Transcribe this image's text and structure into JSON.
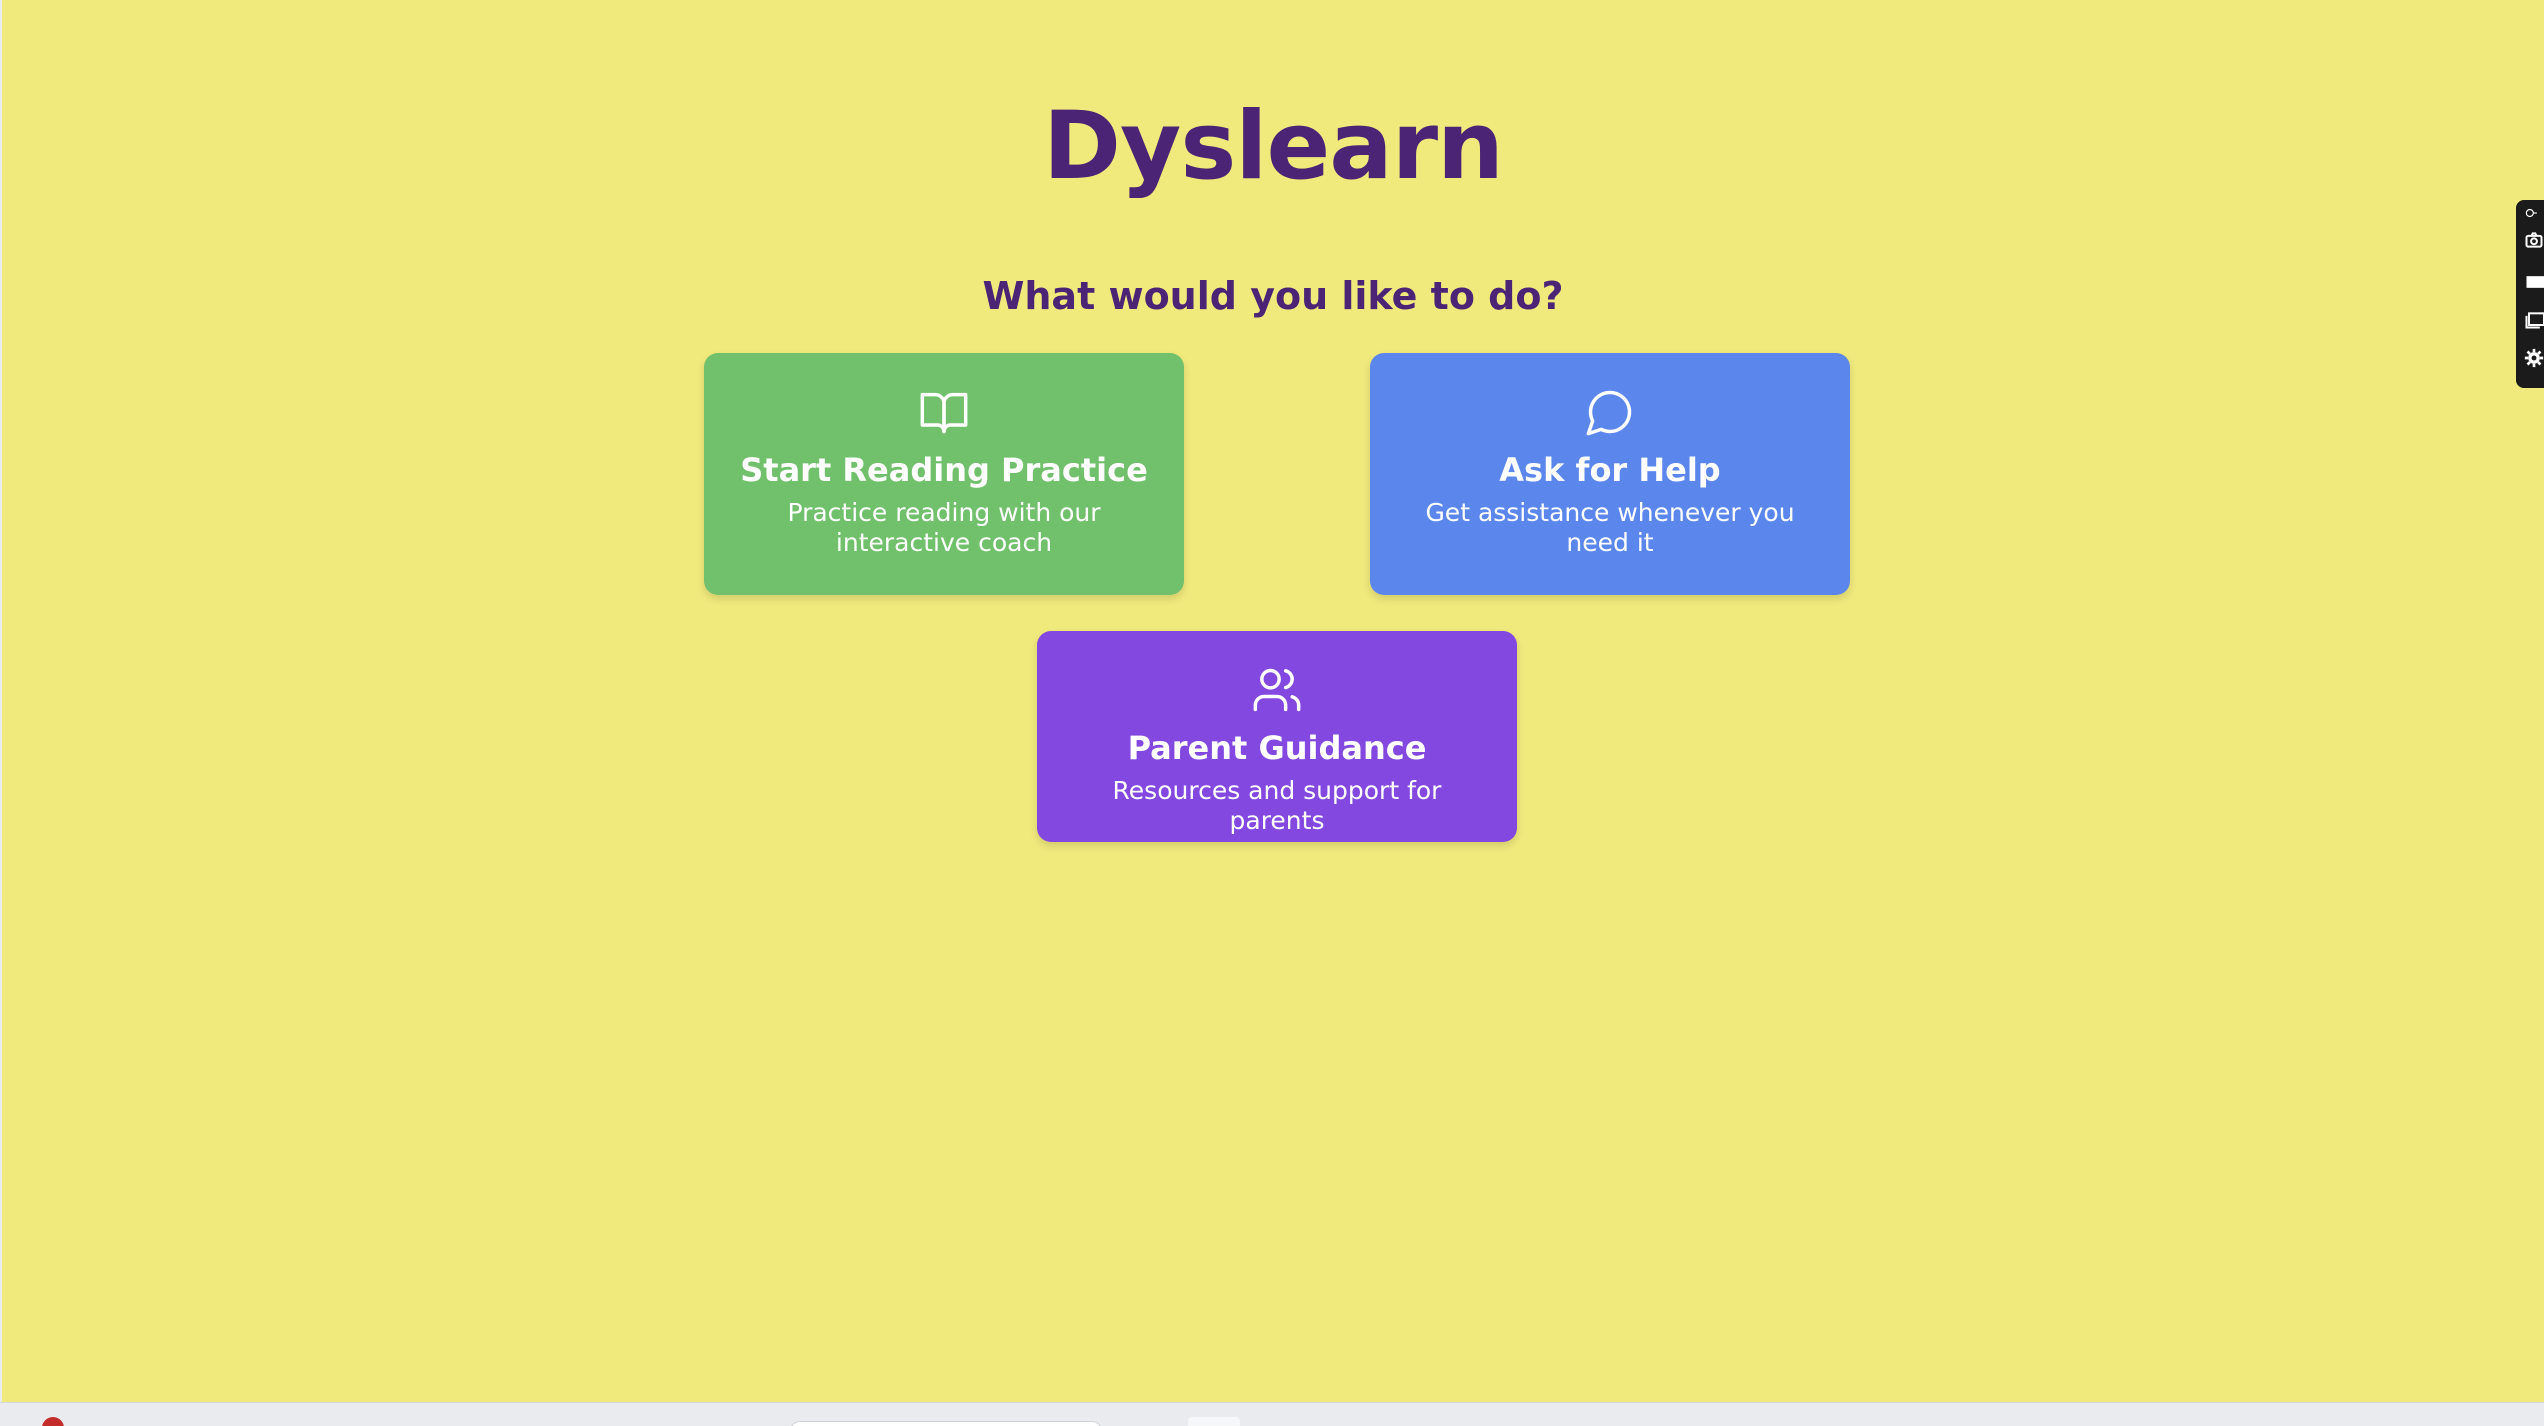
{
  "app": {
    "title": "Dyslearn",
    "prompt": "What would you like to do?"
  },
  "cards": {
    "reading": {
      "icon": "open-book-icon",
      "title": "Start Reading Practice",
      "description": "Practice reading with our interactive coach",
      "color": "#71c06b"
    },
    "help": {
      "icon": "chat-bubble-icon",
      "title": "Ask for Help",
      "description": "Get assistance whenever you need it",
      "color": "#5b87ec"
    },
    "parent": {
      "icon": "users-icon",
      "title": "Parent Guidance",
      "description": "Resources and support for parents",
      "color": "#8248e0"
    }
  },
  "side_toolbar": {
    "icons": [
      "extension-icon",
      "camera-icon",
      "rectangle-icon",
      "window-icon",
      "gear-icon"
    ]
  },
  "colors": {
    "background": "#f0e97c",
    "heading": "#4b2475"
  }
}
